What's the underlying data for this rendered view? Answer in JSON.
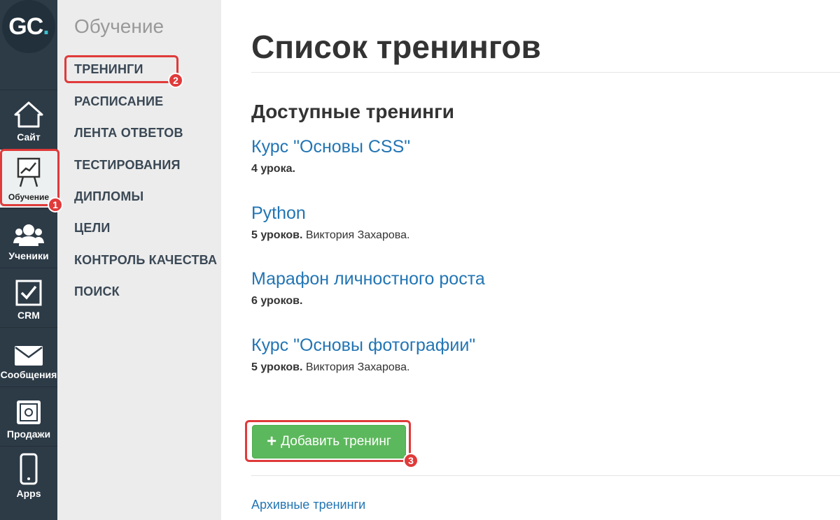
{
  "rail": {
    "logo": {
      "text": "GC",
      "dot": "."
    },
    "items": [
      {
        "label": "Сайт",
        "icon": "home-icon"
      },
      {
        "label": "Обучение",
        "icon": "chart-board-icon",
        "active": true
      },
      {
        "label": "Ученики",
        "icon": "users-icon"
      },
      {
        "label": "CRM",
        "icon": "checkbox-icon"
      },
      {
        "label": "Сообщения",
        "icon": "envelope-icon"
      },
      {
        "label": "Продажи",
        "icon": "safe-icon"
      },
      {
        "label": "Apps",
        "icon": "phone-icon"
      }
    ]
  },
  "submenu": {
    "title": "Обучение",
    "items": [
      "ТРЕНИНГИ",
      "РАСПИСАНИЕ",
      "ЛЕНТА ОТВЕТОВ",
      "ТЕСТИРОВАНИЯ",
      "ДИПЛОМЫ",
      "ЦЕЛИ",
      "КОНТРОЛЬ КАЧЕСТВА",
      "ПОИСК"
    ]
  },
  "main": {
    "title": "Список тренингов",
    "section_title": "Доступные тренинги",
    "courses": [
      {
        "name": "Курс \"Основы CSS\"",
        "lessons": "4 урока.",
        "author": ""
      },
      {
        "name": "Python",
        "lessons": "5 уроков.",
        "author": " Виктория Захарова."
      },
      {
        "name": "Марафон личностного роста",
        "lessons": "6 уроков.",
        "author": ""
      },
      {
        "name": "Курс \"Основы фотографии\"",
        "lessons": "5 уроков.",
        "author": " Виктория Захарова."
      }
    ],
    "add_button": "Добавить тренинг",
    "archive_link": "Архивные тренинги"
  },
  "annotations": [
    "1",
    "2",
    "3"
  ],
  "colors": {
    "rail": "#2d3b47",
    "accent_red": "#e03a3a",
    "link": "#2275b4",
    "button_green": "#5cb85c"
  }
}
